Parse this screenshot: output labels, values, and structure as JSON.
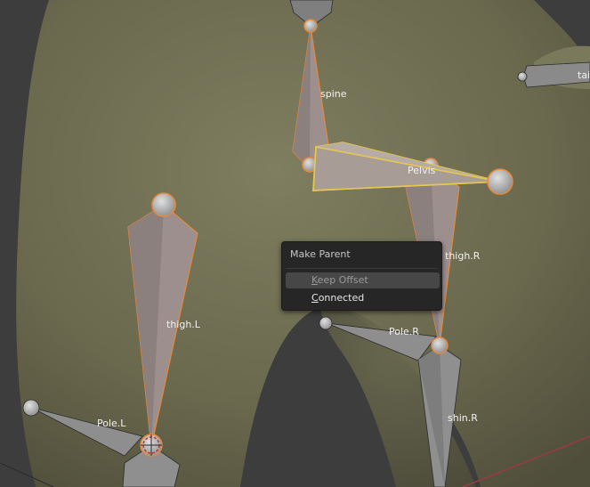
{
  "viewport": {
    "bones": {
      "spine": "spine",
      "pelvis": "Pelvis",
      "thigh_r": "thigh.R",
      "thigh_l": "thigh.L",
      "pole_l": "Pole.L",
      "pole_r": "Pole.R",
      "shin_r": "shin.R",
      "tail_partial": "tai"
    }
  },
  "menu": {
    "title": "Make Parent",
    "items": [
      {
        "first": "K",
        "rest": "eep Offset"
      },
      {
        "first": "C",
        "rest": "onnected"
      }
    ]
  },
  "colors": {
    "mesh": "#6b6a4e",
    "background": "#3d3d3d",
    "selected_outline": "#e8893a",
    "active_outline": "#e6c84d",
    "axis_red": "#9a3a44",
    "bone_fill": "#9e9493"
  }
}
